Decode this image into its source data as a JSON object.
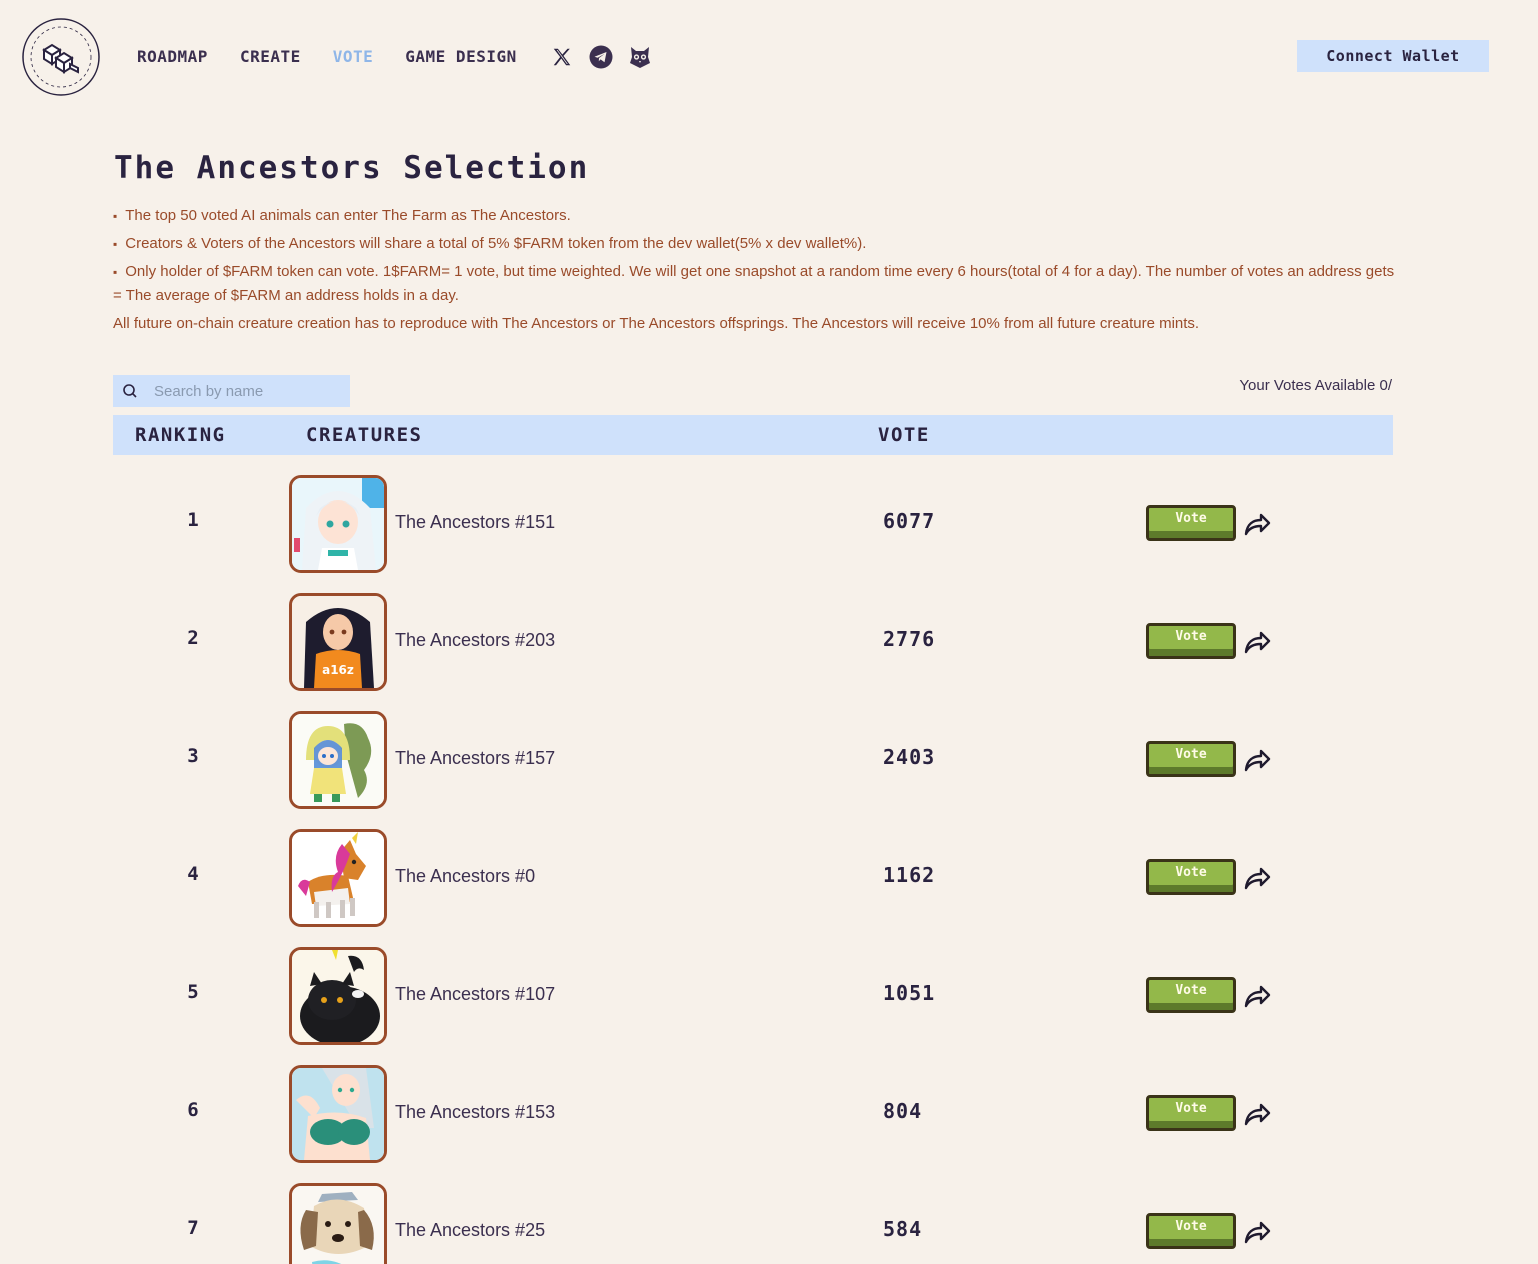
{
  "logo": {
    "ring_text": "FARM · FARM · FARM · FARM · FARM ·"
  },
  "nav": {
    "links": [
      {
        "label": "ROADMAP",
        "active": false
      },
      {
        "label": "CREATE",
        "active": false
      },
      {
        "label": "VOTE",
        "active": true
      },
      {
        "label": "GAME DESIGN",
        "active": false
      }
    ],
    "social_icons": [
      "x-twitter-icon",
      "telegram-icon",
      "owl-icon"
    ]
  },
  "connect_wallet": "Connect Wallet",
  "page_title": "The Ancestors Selection",
  "description": [
    "The top 50 voted AI animals can enter The Farm as The Ancestors.",
    "Creators & Voters of the Ancestors will share a total of 5% $FARM token from the dev wallet(5% x dev wallet%).",
    "Only holder of $FARM token can vote. 1$FARM= 1 vote, but time weighted. We will get one snapshot at a random time every 6 hours(total of 4 for a day). The number of votes an address gets = The average of $FARM an address holds in a day.",
    "All future on-chain creature creation has to reproduce with The Ancestors or The Ancestors offsprings. The Ancestors will receive 10% from all future creature mints."
  ],
  "search": {
    "placeholder": "Search by name",
    "value": ""
  },
  "votes_available": "Your Votes Available 0/",
  "table": {
    "headers": {
      "ranking": "RANKING",
      "creatures": "CREATURES",
      "vote": "VOTE"
    },
    "vote_button_label": "Vote",
    "rows": [
      {
        "rank": "1",
        "name": "The Ancestors #151",
        "votes": "6077"
      },
      {
        "rank": "2",
        "name": "The Ancestors #203",
        "votes": "2776"
      },
      {
        "rank": "3",
        "name": "The Ancestors #157",
        "votes": "2403"
      },
      {
        "rank": "4",
        "name": "The Ancestors #0",
        "votes": "1162"
      },
      {
        "rank": "5",
        "name": "The Ancestors #107",
        "votes": "1051"
      },
      {
        "rank": "6",
        "name": "The Ancestors #153",
        "votes": "804"
      },
      {
        "rank": "7",
        "name": "The Ancestors #25",
        "votes": "584"
      }
    ]
  },
  "colors": {
    "background": "#f7f1ea",
    "accent_blue": "#cfe1fb",
    "active_nav": "#8fb6e8",
    "description_text": "#9a4b2a",
    "vote_button": "#93b84a",
    "thumb_border": "#9a4b2a"
  }
}
